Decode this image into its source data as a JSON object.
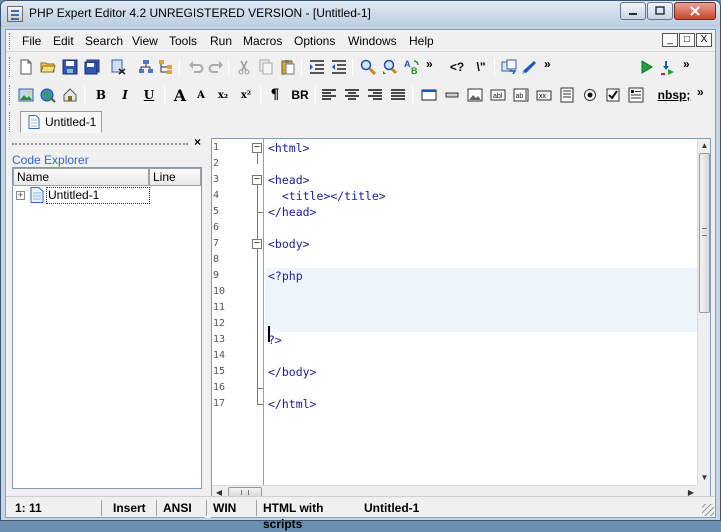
{
  "window": {
    "title": "PHP Expert Editor 4.2 UNREGISTERED VERSION - [Untitled-1]",
    "caption_buttons": [
      "minimize",
      "maximize",
      "close"
    ]
  },
  "menubar": {
    "items": [
      "File",
      "Edit",
      "Search",
      "View",
      "Tools",
      "Run",
      "Macros",
      "Options",
      "Windows",
      "Help"
    ],
    "mdi_buttons": [
      "_",
      "□",
      "X"
    ]
  },
  "toolbar1": {
    "chevron": "»",
    "icons": [
      "new-file-icon",
      "open-folder-icon",
      "save-icon",
      "save-all-icon",
      "close-file-icon",
      "tree-icon",
      "structure-icon",
      "undo-icon",
      "redo-icon",
      "cut-icon",
      "copy-icon",
      "paste-icon",
      "indent-icon",
      "outdent-icon",
      "find-icon",
      "find-next-icon",
      "replace-icon",
      "html-tag-icon",
      "escape-icon",
      "sync-icon",
      "check-icon",
      "run-icon",
      "debug-icon"
    ],
    "tag_label": "<?",
    "escape_label": "\\\""
  },
  "toolbar2": {
    "chevron": "»",
    "bold": "B",
    "italic": "I",
    "underline": "U",
    "font_larger": "A",
    "font_smaller": "A",
    "subscript": "x₂",
    "superscript": "x²",
    "paragraph": "¶",
    "line_break": "BR",
    "nbsp": "nbsp;"
  },
  "tabs": {
    "documents": [
      {
        "label": "Untitled-1"
      }
    ]
  },
  "explorer": {
    "title": "Code Explorer",
    "close": "×",
    "columns": [
      "Name",
      "Line"
    ],
    "nodes": [
      {
        "label": "Untitled-1",
        "expander": "+"
      }
    ]
  },
  "editor": {
    "lines": [
      {
        "n": "1",
        "text": "<html>"
      },
      {
        "n": "2",
        "text": ""
      },
      {
        "n": "3",
        "text": "<head>"
      },
      {
        "n": "4",
        "text": "  <title></title>"
      },
      {
        "n": "5",
        "text": "</head>"
      },
      {
        "n": "6",
        "text": ""
      },
      {
        "n": "7",
        "text": "<body>"
      },
      {
        "n": "8",
        "text": ""
      },
      {
        "n": "9",
        "text": "<?php"
      },
      {
        "n": "10",
        "text": ""
      },
      {
        "n": "11",
        "text": ""
      },
      {
        "n": "12",
        "text": ""
      },
      {
        "n": "13",
        "text": "?>"
      },
      {
        "n": "14",
        "text": ""
      },
      {
        "n": "15",
        "text": "</body>"
      },
      {
        "n": "16",
        "text": ""
      },
      {
        "n": "17",
        "text": "</html>"
      }
    ],
    "fold_marker": "−",
    "scroll": {
      "up": "▲",
      "down": "▼",
      "left": "◀",
      "right": "▶"
    }
  },
  "statusbar": {
    "position": "1: 11",
    "mode": "Insert",
    "encoding": "ANSI",
    "line_endings": "WIN",
    "syntax": "HTML with scripts",
    "filename": "Untitled-1"
  }
}
